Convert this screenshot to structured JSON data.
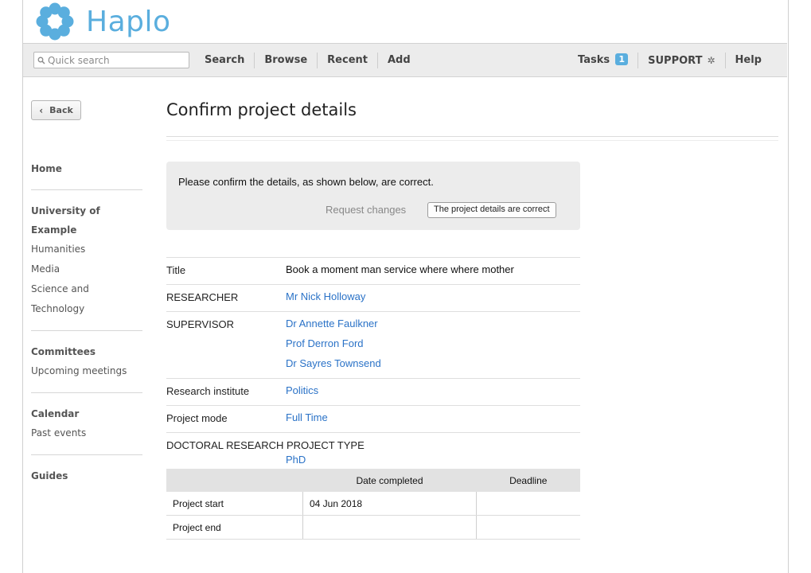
{
  "app": {
    "name": "Haplo",
    "brand_color": "#5aaede",
    "link_color": "#2a72c7"
  },
  "nav": {
    "search_placeholder": "Quick search",
    "left": [
      "Search",
      "Browse",
      "Recent",
      "Add"
    ],
    "tasks_label": "Tasks",
    "tasks_count": "1",
    "support_label": "SUPPORT",
    "help_label": "Help"
  },
  "sidebar": {
    "back_label": "Back",
    "groups": [
      {
        "heading": "Home",
        "items": []
      },
      {
        "heading": "University of Example",
        "items": [
          "Humanities",
          "Media",
          "Science and Technology"
        ]
      },
      {
        "heading": "Committees",
        "items": [
          "Upcoming meetings"
        ]
      },
      {
        "heading": "Calendar",
        "items": [
          "Past events"
        ]
      },
      {
        "heading": "Guides",
        "items": []
      }
    ]
  },
  "page": {
    "title": "Confirm project details",
    "confirm_message": "Please confirm the details, as shown below, are correct.",
    "request_changes": "Request changes",
    "correct_button": "The project details are correct"
  },
  "details": [
    {
      "label": "Title",
      "values": [
        "Book a moment man service where where mother"
      ],
      "link": false
    },
    {
      "label": "RESEARCHER",
      "values": [
        "Mr Nick Holloway"
      ],
      "link": true
    },
    {
      "label": "SUPERVISOR",
      "values": [
        "Dr Annette Faulkner",
        "Prof Derron Ford",
        "Dr Sayres Townsend"
      ],
      "link": true
    },
    {
      "label": "Research institute",
      "values": [
        "Politics"
      ],
      "link": true
    },
    {
      "label": "Project mode",
      "values": [
        "Full Time"
      ],
      "link": true
    },
    {
      "label": "DOCTORAL RESEARCH PROJECT TYPE",
      "values": [
        "PhD"
      ],
      "link": true,
      "stacked": true
    }
  ],
  "dates": {
    "headers": [
      "",
      "Date completed",
      "Deadline"
    ],
    "rows": [
      [
        "Project start",
        "04 Jun 2018",
        ""
      ],
      [
        "Project end",
        "",
        ""
      ]
    ]
  }
}
